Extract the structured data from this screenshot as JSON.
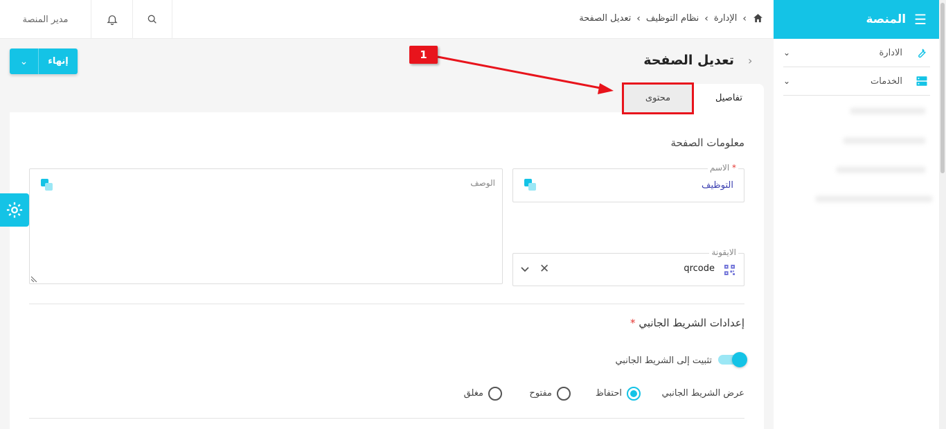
{
  "topbar": {
    "user_name": "مدير المنصة",
    "breadcrumb": [
      "الإدارة",
      "نظام التوظيف",
      "تعديل الصفحة"
    ],
    "icons": {
      "home": "home-icon",
      "search": "search-icon",
      "bell": "bell-icon"
    }
  },
  "sidebar": {
    "title": "المنصة",
    "items": [
      {
        "label": "الادارة",
        "icon": "wrench-icon"
      },
      {
        "label": "الخدمات",
        "icon": "server-icon"
      }
    ]
  },
  "page": {
    "title": "تعديل الصفحة",
    "finish_label": "إنهاء"
  },
  "tabs": [
    {
      "label": "تفاصيل",
      "active": true
    },
    {
      "label": "محتوى",
      "active": false
    }
  ],
  "form": {
    "section_title": "معلومات الصفحة",
    "name_label": "الاسم",
    "name_required_mark": "*",
    "name_value": "التوظيف",
    "description_label": "الوصف",
    "icon_label": "الايقونة",
    "icon_value": "qrcode"
  },
  "sidebar_settings": {
    "title": "إعدادات الشريط الجانبي",
    "required_mark": "*",
    "pin_label": "تثبيت إلى الشريط الجانبي",
    "pin_enabled": true,
    "display_label": "عرض الشريط الجانبي",
    "options": [
      "احتفاظ",
      "مفتوح",
      "مغلق"
    ],
    "selected_option": "احتفاظ"
  },
  "annotation": {
    "badge": "1"
  },
  "colors": {
    "accent": "#14c3e6",
    "annotation": "#e8141c"
  }
}
